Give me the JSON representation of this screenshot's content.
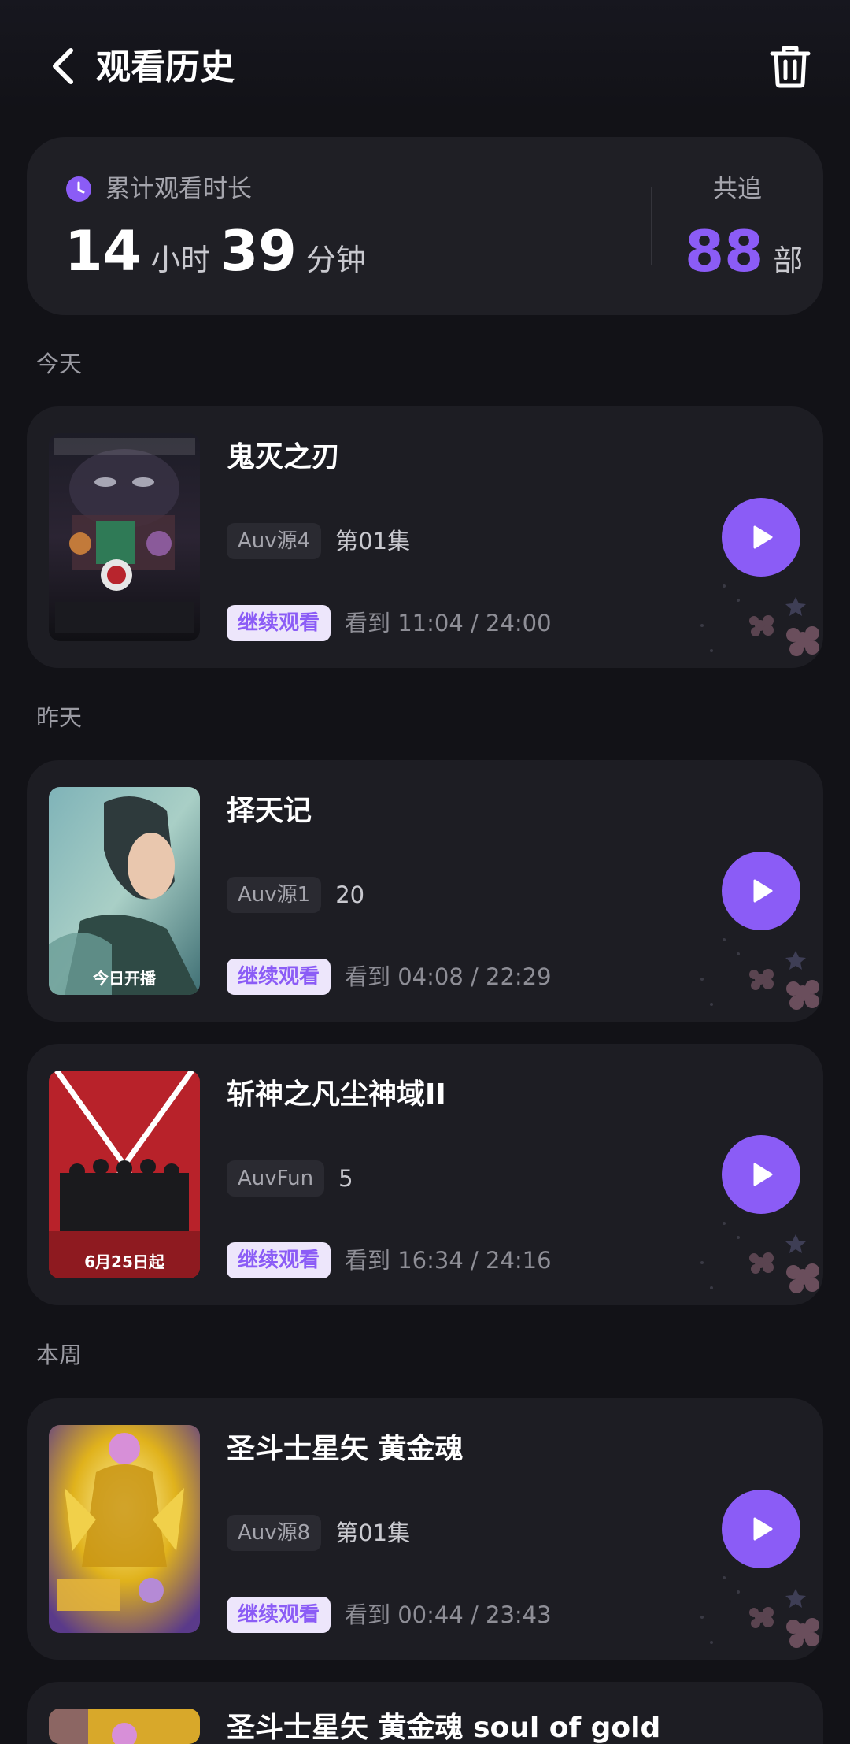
{
  "header": {
    "title": "观看历史"
  },
  "summary": {
    "label": "累计观看时长",
    "hours": "14",
    "hours_unit": "小时",
    "minutes": "39",
    "minutes_unit": "分钟",
    "follow_label": "共追",
    "follow_count": "88",
    "follow_unit": "部"
  },
  "sections": {
    "today": "今天",
    "yesterday": "昨天",
    "this_week": "本周"
  },
  "items": [
    {
      "title": "鬼灭之刃",
      "source": "Auv源4",
      "episode": "第01集",
      "continue": "继续观看",
      "progress": "看到 11:04 / 24:00",
      "poster_caption": ""
    },
    {
      "title": "择天记",
      "source": "Auv源1",
      "episode": "20",
      "continue": "继续观看",
      "progress": "看到 04:08 / 22:29",
      "poster_caption": "今日开播"
    },
    {
      "title": "斩神之凡尘神域II",
      "source": "AuvFun",
      "episode": "5",
      "continue": "继续观看",
      "progress": "看到 16:34 / 24:16",
      "poster_caption": "6月25日起"
    },
    {
      "title": "圣斗士星矢 黄金魂",
      "source": "Auv源8",
      "episode": "第01集",
      "continue": "继续观看",
      "progress": "看到 00:44 / 23:43",
      "poster_caption": ""
    },
    {
      "title": "圣斗士星矢 黄金魂 soul of gold"
    }
  ],
  "icons": {
    "back": "chevron-left-icon",
    "delete": "trash-icon",
    "clock": "clock-icon",
    "play": "play-icon"
  },
  "colors": {
    "accent": "#8b5cf6",
    "background": "#121217",
    "card": "#1d1d23",
    "continue_bg": "#ede6fb"
  }
}
